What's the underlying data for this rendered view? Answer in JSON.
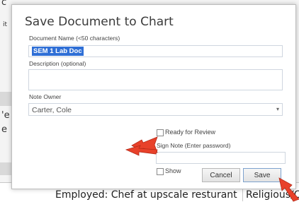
{
  "background": {
    "fragments": [
      "c",
      "it",
      "'e",
      "e"
    ],
    "bottom_row": {
      "left_cell": "Employed: Chef at upscale resturant",
      "right_cell": "Religious/Cu"
    }
  },
  "dialog": {
    "title": "Save Document to Chart",
    "document_name": {
      "label": "Document Name  (<50 characters)",
      "value": "SEM 1 Lab Doc"
    },
    "description": {
      "label": "Description  (optional)",
      "value": ""
    },
    "note_owner": {
      "label": "Note Owner",
      "value": "Carter, Cole"
    },
    "ready_for_review": {
      "label": "Ready for Review",
      "checked": false
    },
    "sign_note": {
      "label": "Sign Note  (Enter password)",
      "value": ""
    },
    "show": {
      "label": "Show",
      "checked": false
    },
    "buttons": {
      "cancel": "Cancel",
      "save": "Save"
    }
  },
  "colors": {
    "selection": "#2f6fd6",
    "annotation_arrow": "#e8412a"
  }
}
